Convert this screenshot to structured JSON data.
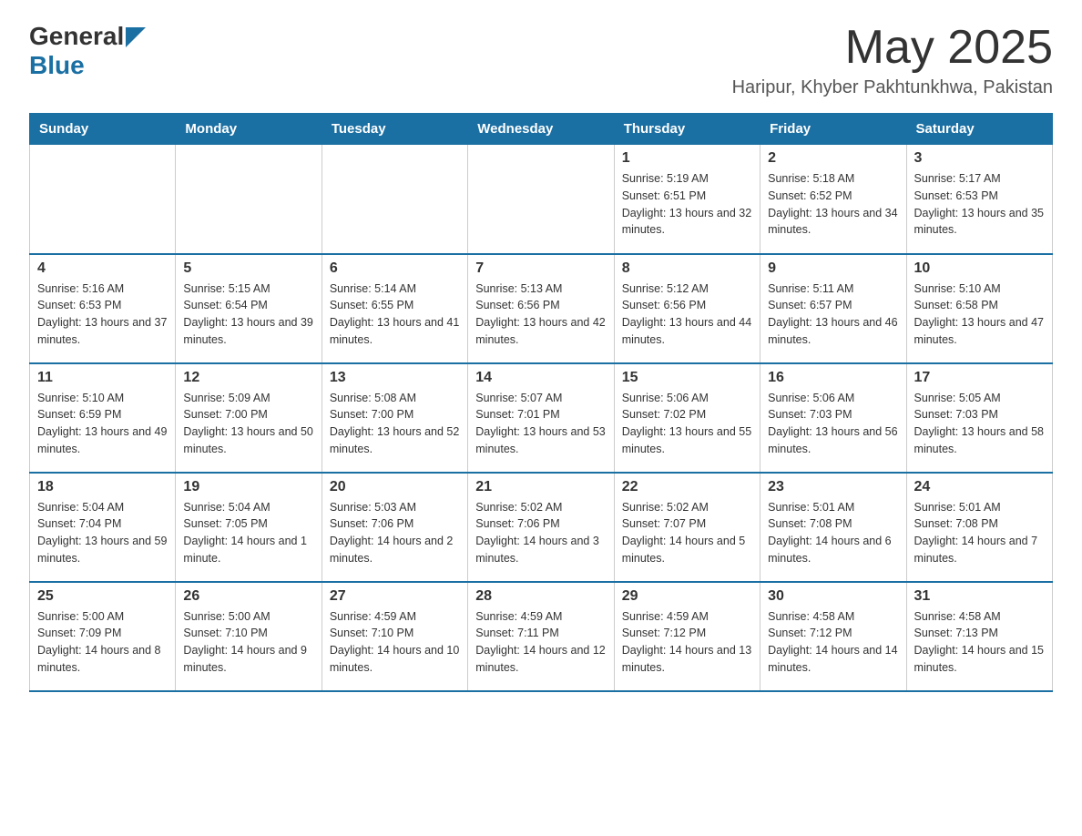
{
  "header": {
    "logo_general": "General",
    "logo_blue": "Blue",
    "title": "May 2025",
    "location": "Haripur, Khyber Pakhtunkhwa, Pakistan"
  },
  "days_of_week": [
    "Sunday",
    "Monday",
    "Tuesday",
    "Wednesday",
    "Thursday",
    "Friday",
    "Saturday"
  ],
  "weeks": [
    {
      "days": [
        {
          "num": "",
          "sunrise": "",
          "sunset": "",
          "daylight": "",
          "empty": true
        },
        {
          "num": "",
          "sunrise": "",
          "sunset": "",
          "daylight": "",
          "empty": true
        },
        {
          "num": "",
          "sunrise": "",
          "sunset": "",
          "daylight": "",
          "empty": true
        },
        {
          "num": "",
          "sunrise": "",
          "sunset": "",
          "daylight": "",
          "empty": true
        },
        {
          "num": "1",
          "sunrise": "Sunrise: 5:19 AM",
          "sunset": "Sunset: 6:51 PM",
          "daylight": "Daylight: 13 hours and 32 minutes."
        },
        {
          "num": "2",
          "sunrise": "Sunrise: 5:18 AM",
          "sunset": "Sunset: 6:52 PM",
          "daylight": "Daylight: 13 hours and 34 minutes."
        },
        {
          "num": "3",
          "sunrise": "Sunrise: 5:17 AM",
          "sunset": "Sunset: 6:53 PM",
          "daylight": "Daylight: 13 hours and 35 minutes."
        }
      ]
    },
    {
      "days": [
        {
          "num": "4",
          "sunrise": "Sunrise: 5:16 AM",
          "sunset": "Sunset: 6:53 PM",
          "daylight": "Daylight: 13 hours and 37 minutes."
        },
        {
          "num": "5",
          "sunrise": "Sunrise: 5:15 AM",
          "sunset": "Sunset: 6:54 PM",
          "daylight": "Daylight: 13 hours and 39 minutes."
        },
        {
          "num": "6",
          "sunrise": "Sunrise: 5:14 AM",
          "sunset": "Sunset: 6:55 PM",
          "daylight": "Daylight: 13 hours and 41 minutes."
        },
        {
          "num": "7",
          "sunrise": "Sunrise: 5:13 AM",
          "sunset": "Sunset: 6:56 PM",
          "daylight": "Daylight: 13 hours and 42 minutes."
        },
        {
          "num": "8",
          "sunrise": "Sunrise: 5:12 AM",
          "sunset": "Sunset: 6:56 PM",
          "daylight": "Daylight: 13 hours and 44 minutes."
        },
        {
          "num": "9",
          "sunrise": "Sunrise: 5:11 AM",
          "sunset": "Sunset: 6:57 PM",
          "daylight": "Daylight: 13 hours and 46 minutes."
        },
        {
          "num": "10",
          "sunrise": "Sunrise: 5:10 AM",
          "sunset": "Sunset: 6:58 PM",
          "daylight": "Daylight: 13 hours and 47 minutes."
        }
      ]
    },
    {
      "days": [
        {
          "num": "11",
          "sunrise": "Sunrise: 5:10 AM",
          "sunset": "Sunset: 6:59 PM",
          "daylight": "Daylight: 13 hours and 49 minutes."
        },
        {
          "num": "12",
          "sunrise": "Sunrise: 5:09 AM",
          "sunset": "Sunset: 7:00 PM",
          "daylight": "Daylight: 13 hours and 50 minutes."
        },
        {
          "num": "13",
          "sunrise": "Sunrise: 5:08 AM",
          "sunset": "Sunset: 7:00 PM",
          "daylight": "Daylight: 13 hours and 52 minutes."
        },
        {
          "num": "14",
          "sunrise": "Sunrise: 5:07 AM",
          "sunset": "Sunset: 7:01 PM",
          "daylight": "Daylight: 13 hours and 53 minutes."
        },
        {
          "num": "15",
          "sunrise": "Sunrise: 5:06 AM",
          "sunset": "Sunset: 7:02 PM",
          "daylight": "Daylight: 13 hours and 55 minutes."
        },
        {
          "num": "16",
          "sunrise": "Sunrise: 5:06 AM",
          "sunset": "Sunset: 7:03 PM",
          "daylight": "Daylight: 13 hours and 56 minutes."
        },
        {
          "num": "17",
          "sunrise": "Sunrise: 5:05 AM",
          "sunset": "Sunset: 7:03 PM",
          "daylight": "Daylight: 13 hours and 58 minutes."
        }
      ]
    },
    {
      "days": [
        {
          "num": "18",
          "sunrise": "Sunrise: 5:04 AM",
          "sunset": "Sunset: 7:04 PM",
          "daylight": "Daylight: 13 hours and 59 minutes."
        },
        {
          "num": "19",
          "sunrise": "Sunrise: 5:04 AM",
          "sunset": "Sunset: 7:05 PM",
          "daylight": "Daylight: 14 hours and 1 minute."
        },
        {
          "num": "20",
          "sunrise": "Sunrise: 5:03 AM",
          "sunset": "Sunset: 7:06 PM",
          "daylight": "Daylight: 14 hours and 2 minutes."
        },
        {
          "num": "21",
          "sunrise": "Sunrise: 5:02 AM",
          "sunset": "Sunset: 7:06 PM",
          "daylight": "Daylight: 14 hours and 3 minutes."
        },
        {
          "num": "22",
          "sunrise": "Sunrise: 5:02 AM",
          "sunset": "Sunset: 7:07 PM",
          "daylight": "Daylight: 14 hours and 5 minutes."
        },
        {
          "num": "23",
          "sunrise": "Sunrise: 5:01 AM",
          "sunset": "Sunset: 7:08 PM",
          "daylight": "Daylight: 14 hours and 6 minutes."
        },
        {
          "num": "24",
          "sunrise": "Sunrise: 5:01 AM",
          "sunset": "Sunset: 7:08 PM",
          "daylight": "Daylight: 14 hours and 7 minutes."
        }
      ]
    },
    {
      "days": [
        {
          "num": "25",
          "sunrise": "Sunrise: 5:00 AM",
          "sunset": "Sunset: 7:09 PM",
          "daylight": "Daylight: 14 hours and 8 minutes."
        },
        {
          "num": "26",
          "sunrise": "Sunrise: 5:00 AM",
          "sunset": "Sunset: 7:10 PM",
          "daylight": "Daylight: 14 hours and 9 minutes."
        },
        {
          "num": "27",
          "sunrise": "Sunrise: 4:59 AM",
          "sunset": "Sunset: 7:10 PM",
          "daylight": "Daylight: 14 hours and 10 minutes."
        },
        {
          "num": "28",
          "sunrise": "Sunrise: 4:59 AM",
          "sunset": "Sunset: 7:11 PM",
          "daylight": "Daylight: 14 hours and 12 minutes."
        },
        {
          "num": "29",
          "sunrise": "Sunrise: 4:59 AM",
          "sunset": "Sunset: 7:12 PM",
          "daylight": "Daylight: 14 hours and 13 minutes."
        },
        {
          "num": "30",
          "sunrise": "Sunrise: 4:58 AM",
          "sunset": "Sunset: 7:12 PM",
          "daylight": "Daylight: 14 hours and 14 minutes."
        },
        {
          "num": "31",
          "sunrise": "Sunrise: 4:58 AM",
          "sunset": "Sunset: 7:13 PM",
          "daylight": "Daylight: 14 hours and 15 minutes."
        }
      ]
    }
  ]
}
